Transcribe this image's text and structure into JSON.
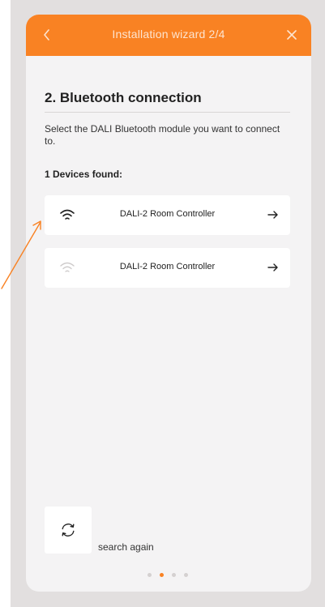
{
  "colors": {
    "accent": "#f98223",
    "background": "#e2dfdf",
    "card": "#f4f3f4"
  },
  "header": {
    "title": "Installation wizard 2/4",
    "back_icon": "chevron-left-icon",
    "close_icon": "close-icon"
  },
  "section": {
    "title": "2. Bluetooth connection",
    "description": "Select the DALI Bluetooth module you want to connect to.",
    "found_label": "1 Devices found:"
  },
  "devices": [
    {
      "name": "DALI-2 Room Controller",
      "signal": "strong",
      "icon": "wifi-icon",
      "action_icon": "arrow-right-icon"
    },
    {
      "name": "DALI-2 Room Controller",
      "signal": "weak",
      "icon": "wifi-icon",
      "action_icon": "arrow-right-icon"
    }
  ],
  "footer": {
    "search_again_label": "search again",
    "refresh_icon": "refresh-icon"
  },
  "pagination": {
    "total": 4,
    "active": 2
  }
}
